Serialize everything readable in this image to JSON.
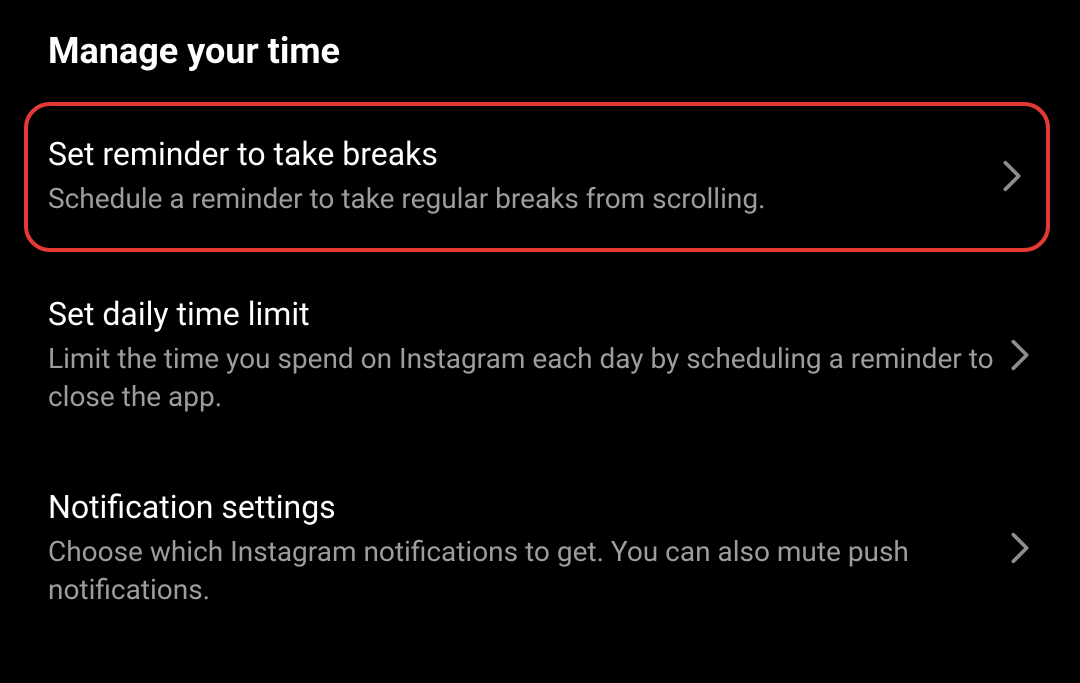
{
  "header": "Manage your time",
  "items": [
    {
      "title": "Set reminder to take breaks",
      "description": "Schedule a reminder to take regular breaks from scrolling.",
      "highlighted": true
    },
    {
      "title": "Set daily time limit",
      "description": "Limit the time you spend on Instagram each day by scheduling a reminder to close the app.",
      "highlighted": false
    },
    {
      "title": "Notification settings",
      "description": "Choose which Instagram notifications to get. You can also mute push notifications.",
      "highlighted": false
    }
  ],
  "colors": {
    "highlight": "#e53935",
    "background": "#000000",
    "textPrimary": "#ffffff",
    "textSecondary": "#9d9d9d"
  }
}
